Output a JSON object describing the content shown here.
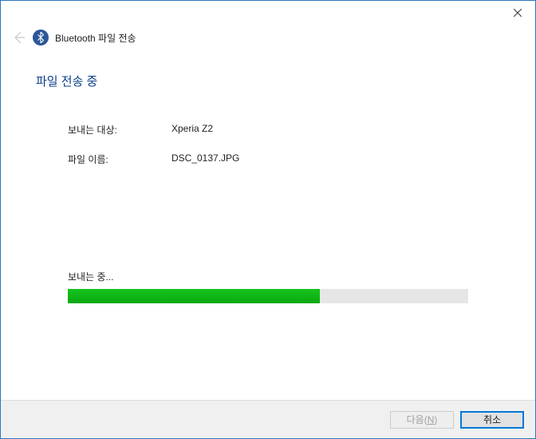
{
  "window": {
    "title": "Bluetooth 파일 전송"
  },
  "page": {
    "heading": "파일 전송 중"
  },
  "fields": {
    "destination_label": "보내는 대상:",
    "destination_value": "Xperia Z2",
    "filename_label": "파일 이름:",
    "filename_value": "DSC_0137.JPG"
  },
  "progress": {
    "label": "보내는 중...",
    "percent": 63
  },
  "buttons": {
    "next_prefix": "다음(",
    "next_key": "N",
    "next_suffix": ")",
    "cancel": "취소"
  }
}
